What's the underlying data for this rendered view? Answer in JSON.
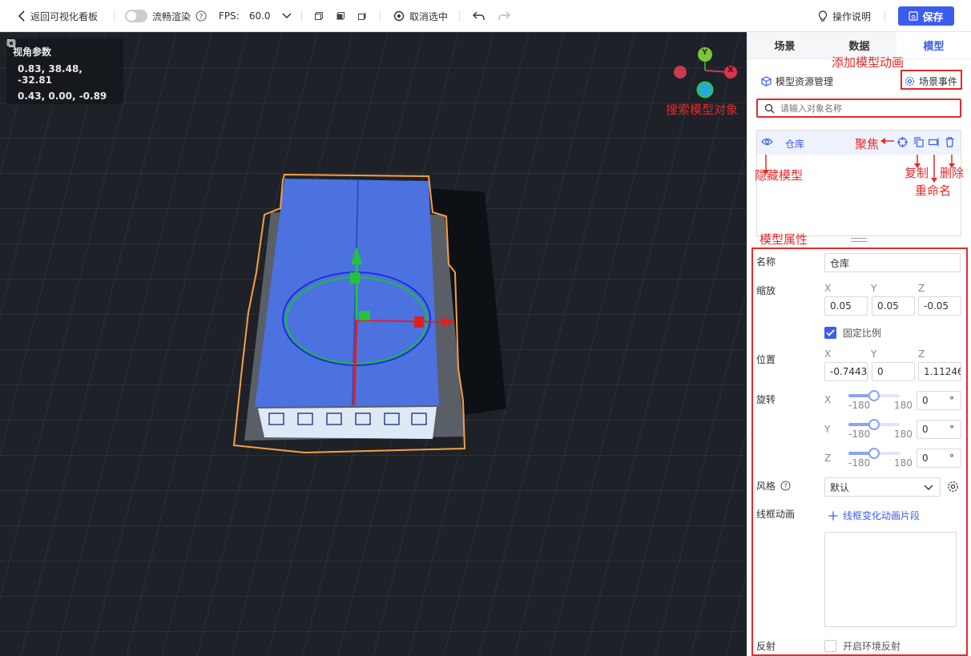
{
  "topbar": {
    "back_label": "返回可视化看板",
    "smooth_render_label": "流畅渲染",
    "fps_label": "FPS:",
    "fps_value": "60.0",
    "deselect_label": "取消选中",
    "help_label": "操作说明",
    "save_label": "保存"
  },
  "camera_panel": {
    "title": "视角参数",
    "position": "0.83, 38.48, -32.81",
    "target": "0.43, 0.00, -0.89"
  },
  "gizmo": {
    "y_label": "Y",
    "x_label": "X"
  },
  "panel": {
    "tabs": [
      "场景",
      "数据",
      "模型"
    ],
    "active_tab": "模型",
    "model_resource_label": "模型资源管理",
    "scene_event_label": "场景事件",
    "search_placeholder": "请输入对象名称",
    "object_list": [
      {
        "name": "仓库"
      }
    ],
    "properties": {
      "name_label": "名称",
      "name_value": "仓库",
      "scale_label": "缩放",
      "scale_axes": [
        "X",
        "Y",
        "Z"
      ],
      "scale_values": [
        "0.05",
        "0.05",
        "-0.05"
      ],
      "lock_ratio_label": "固定比例",
      "position_label": "位置",
      "position_axes": [
        "X",
        "Y",
        "Z"
      ],
      "position_values": [
        "-0.7443",
        "0",
        "1.11246"
      ],
      "rotation_label": "旋转",
      "rotation_rows": [
        {
          "axis": "X",
          "min": "-180",
          "max": "180",
          "value": "0",
          "unit": "°",
          "level": 0.5
        },
        {
          "axis": "Y",
          "min": "-180",
          "max": "180",
          "value": "0",
          "unit": "°",
          "level": 0.5
        },
        {
          "axis": "Z",
          "min": "-180",
          "max": "180",
          "value": "0",
          "unit": "°",
          "level": 0.5
        }
      ],
      "style_label": "风格",
      "style_value": "默认",
      "wire_anim_label": "线框动画",
      "wire_anim_add_label": "线框变化动画片段",
      "reflect_label": "反射",
      "reflect_toggle_label": "开启环境反射"
    }
  },
  "annotations": {
    "add_anim": "添加模型动画",
    "search_obj": "搜索模型对象",
    "focus": "聚焦",
    "hide": "隐藏模型",
    "copy": "复制",
    "delete": "删除",
    "rename": "重命名",
    "props": "模型属性"
  },
  "colors": {
    "accent": "#3c5cf0",
    "annotation_red": "#e52a2a",
    "viewport_bg": "#1e2228",
    "selection_orange": "#f7a040"
  }
}
